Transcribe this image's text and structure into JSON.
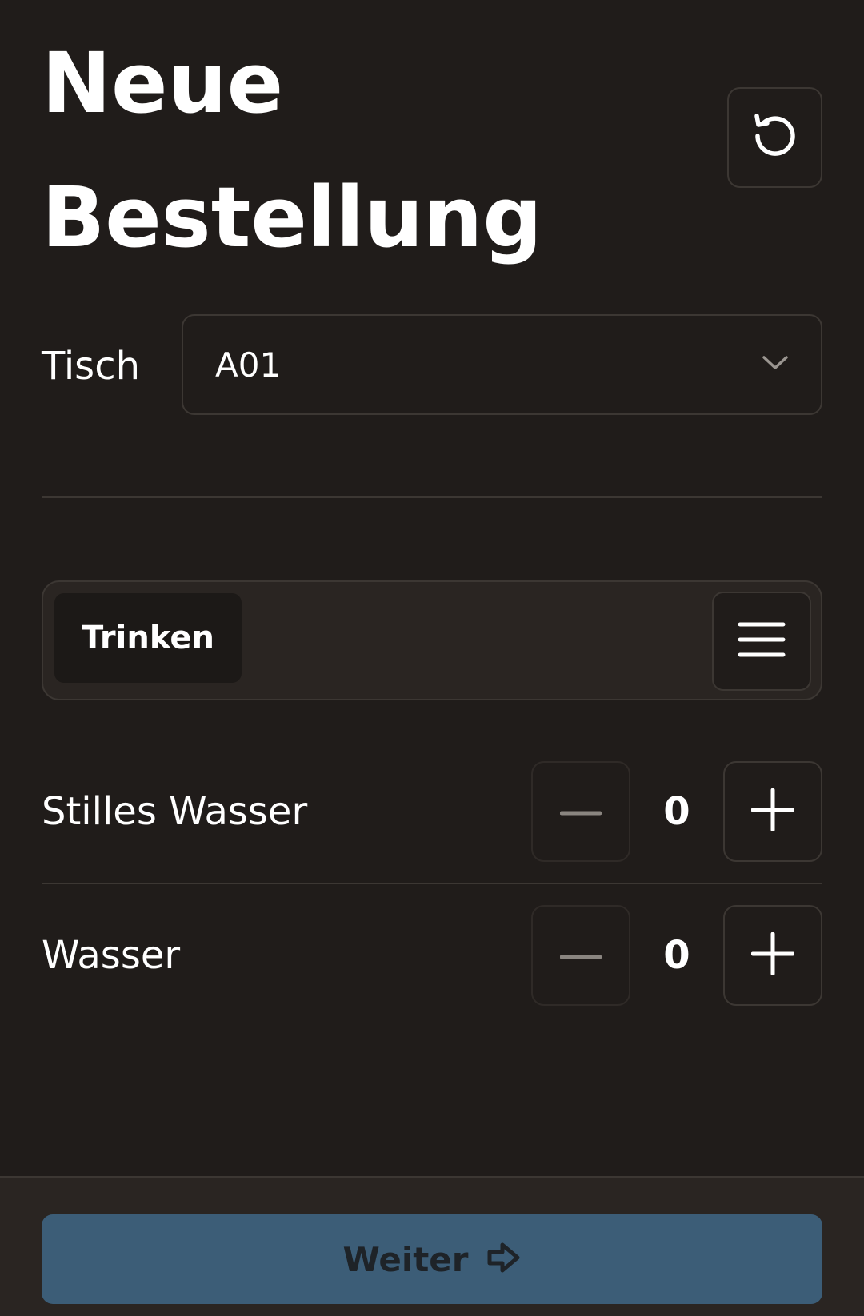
{
  "header": {
    "title": "Neue Bestellung",
    "reset_icon": "reset-rotate-icon"
  },
  "table": {
    "label": "Tisch",
    "selected": "A01",
    "dropdown_icon": "chevron-down-icon"
  },
  "categories": {
    "tabs": [
      {
        "label": "Trinken",
        "active": true
      }
    ],
    "menu_icon": "hamburger-menu-icon"
  },
  "items": [
    {
      "name": "Stilles Wasser",
      "quantity": "0"
    },
    {
      "name": "Wasser",
      "quantity": "0"
    }
  ],
  "footer": {
    "next_label": "Weiter",
    "next_icon": "arrow-right-icon"
  },
  "colors": {
    "background": "#201c1a",
    "border": "#3c3733",
    "accent": "#3c5d77",
    "button_text": "#1e2328"
  }
}
